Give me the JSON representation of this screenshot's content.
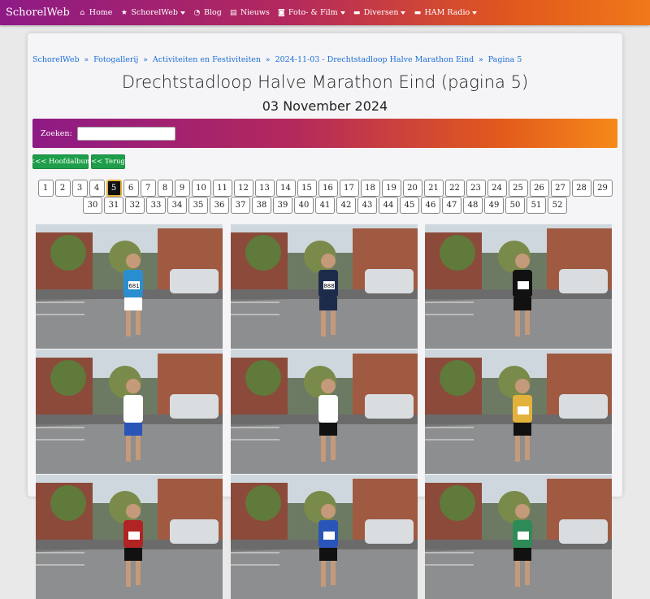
{
  "nav": {
    "brand": "SchorelWeb",
    "items": [
      {
        "label": "Home",
        "icon": "home-icon",
        "glyph": "⌂",
        "dropdown": false
      },
      {
        "label": "SchorelWeb",
        "icon": "star-icon",
        "glyph": "★",
        "dropdown": true
      },
      {
        "label": "Blog",
        "icon": "rss-icon",
        "glyph": "◔",
        "dropdown": false
      },
      {
        "label": "Nieuws",
        "icon": "newspaper-icon",
        "glyph": "▤",
        "dropdown": false
      },
      {
        "label": "Foto- & Film",
        "icon": "camera-icon",
        "glyph": "◙",
        "dropdown": true
      },
      {
        "label": "Diversen",
        "icon": "folder-icon",
        "glyph": "▬",
        "dropdown": true
      },
      {
        "label": "HAM Radio",
        "icon": "folder-icon",
        "glyph": "▬",
        "dropdown": true
      }
    ]
  },
  "breadcrumb": [
    "SchorelWeb",
    "Fotogallerij",
    "Activiteiten en Festiviteiten",
    "2024-11-03 - Drechtstadloop Halve Marathon Eind",
    "Pagina 5"
  ],
  "page": {
    "title": "Drechtstadloop Halve Marathon Eind (pagina 5)",
    "date": "03 November 2024"
  },
  "search": {
    "label": "Zoeken:",
    "value": "",
    "placeholder": ""
  },
  "buttons": {
    "main_album": "<<< Hoofdalbum",
    "back": "<< Terug"
  },
  "pagination": {
    "current": "5",
    "row1": [
      "1",
      "2",
      "3",
      "4",
      "5",
      "6",
      "7",
      "8",
      "9",
      "10",
      "11",
      "12",
      "13",
      "14",
      "15",
      "16",
      "17",
      "18",
      "19",
      "20",
      "21",
      "22",
      "23",
      "24",
      "25",
      "26",
      "27",
      "28",
      "29"
    ],
    "row2": [
      "30",
      "31",
      "32",
      "33",
      "34",
      "35",
      "36",
      "37",
      "38",
      "39",
      "40",
      "41",
      "42",
      "43",
      "44",
      "45",
      "46",
      "47",
      "48",
      "49",
      "50",
      "51",
      "52"
    ]
  },
  "photos": [
    {
      "bib": "681",
      "shirt": "#2a8ed0",
      "shorts": "#ffffff"
    },
    {
      "bib": "888",
      "shirt": "#1c2b4a",
      "shorts": "#1c2b4a"
    },
    {
      "bib": "",
      "shirt": "#111111",
      "shorts": "#111111"
    },
    {
      "bib": "",
      "shirt": "#ffffff",
      "shorts": "#2a55b8"
    },
    {
      "bib": "",
      "shirt": "#ffffff",
      "shorts": "#111111"
    },
    {
      "bib": "",
      "shirt": "#e3b23c",
      "shorts": "#111111"
    },
    {
      "bib": "",
      "shirt": "#b02424",
      "shorts": "#111111"
    },
    {
      "bib": "",
      "shirt": "#2a55b8",
      "shorts": "#111111"
    },
    {
      "bib": "",
      "shirt": "#2e8b57",
      "shorts": "#111111"
    }
  ],
  "colors": {
    "accent_start": "#8e1a86",
    "accent_end": "#f0791a",
    "button_green": "#1e9e4a",
    "link": "#1b6fd6"
  }
}
